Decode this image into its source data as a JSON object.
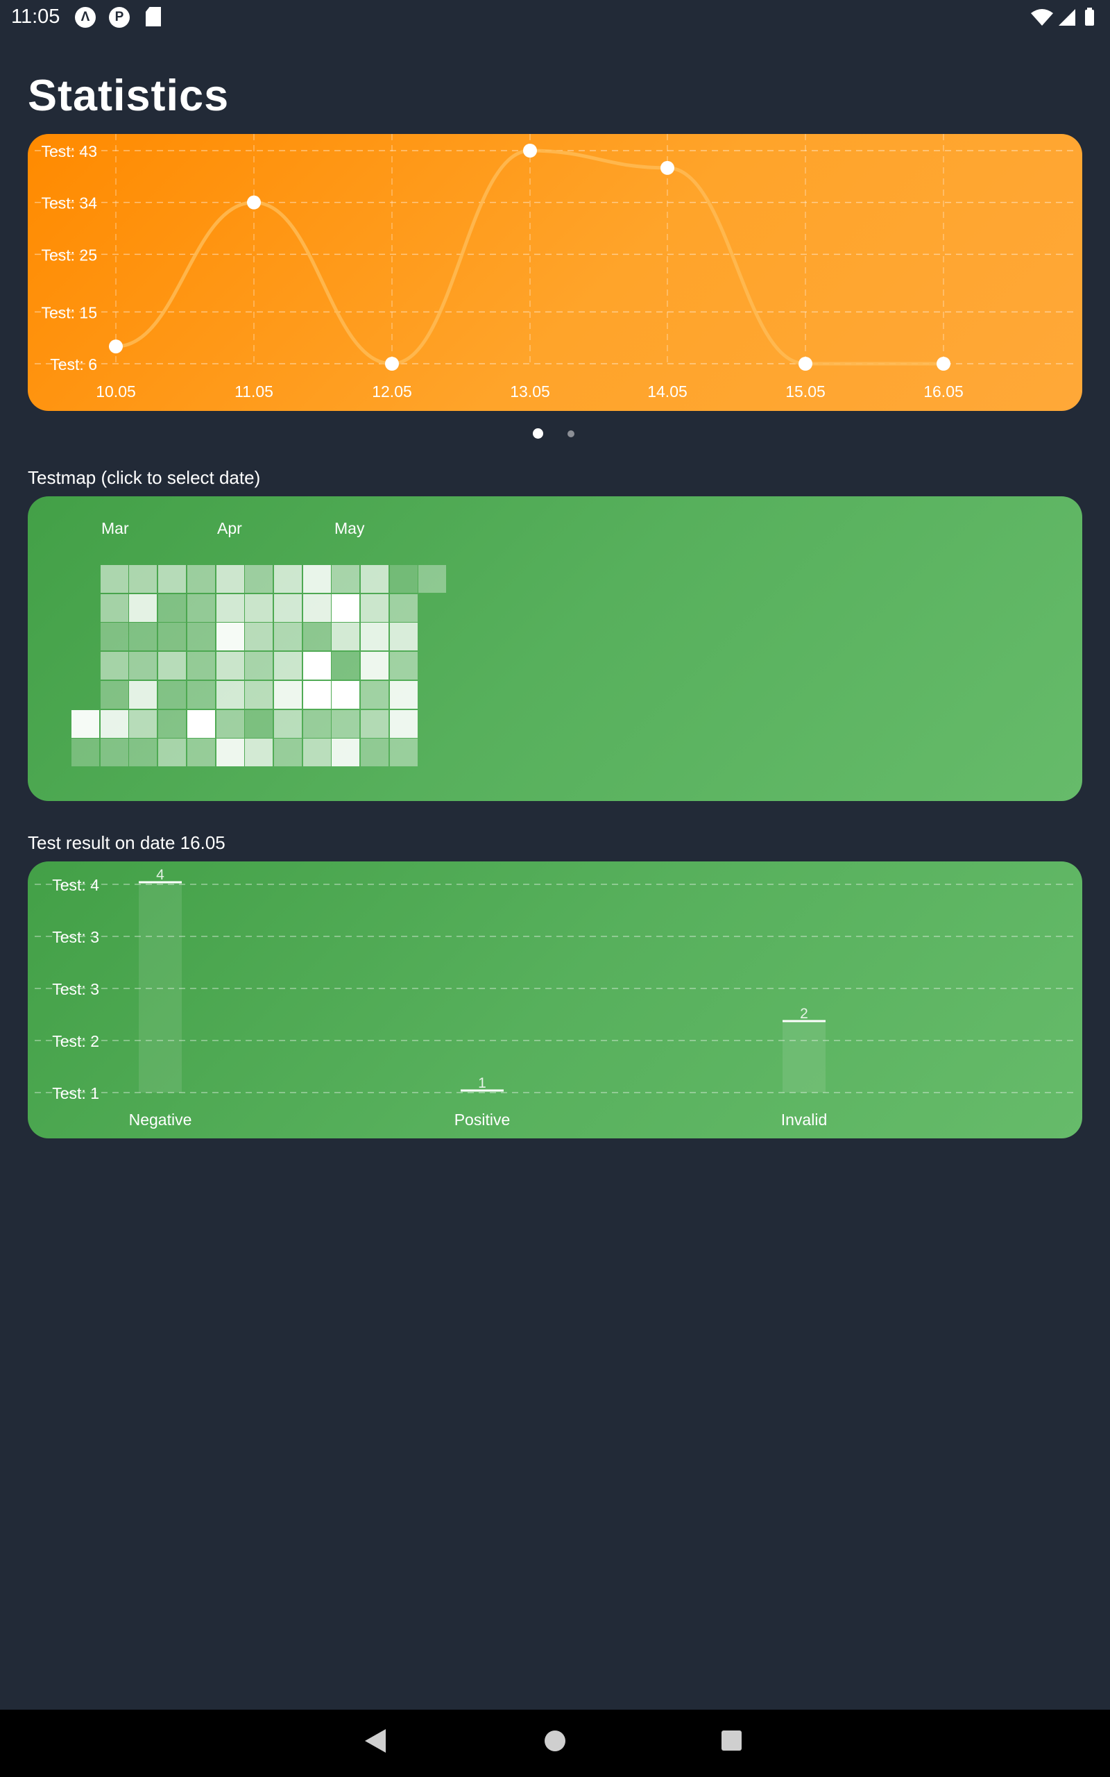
{
  "status_bar": {
    "time": "11:05",
    "left_icons": [
      "app-a-icon",
      "app-p-icon",
      "sd-card-icon"
    ],
    "right_icons": [
      "wifi-icon",
      "signal-icon",
      "battery-icon"
    ]
  },
  "page": {
    "title": "Statistics"
  },
  "line_card": {
    "chart_data": {
      "type": "line",
      "x": [
        "10.05",
        "11.05",
        "12.05",
        "13.05",
        "14.05",
        "15.05",
        "16.05"
      ],
      "values": [
        9,
        34,
        6,
        45,
        40,
        6,
        6
      ],
      "y_tick_labels": [
        "Test: 43",
        "Test: 34",
        "Test: 25",
        "Test: 15",
        "Test: 6"
      ],
      "y_ticks": [
        43,
        34,
        25,
        15,
        6
      ],
      "grid": true,
      "line_color": "#ffbb55",
      "point_color": "#ffffff"
    }
  },
  "pager": {
    "pages": 2,
    "active_index": 0
  },
  "testmap": {
    "label": "Testmap (click to select date)",
    "months": [
      "Mar",
      "Apr",
      "May"
    ],
    "heatmap": {
      "type": "heatmap",
      "note_values": "opacity 0..1 per cell, column-major (weeks), rows = weekdays; null = empty",
      "columns": [
        [
          null,
          null,
          null,
          null,
          null,
          0.95,
          0.25
        ],
        [
          0.55,
          0.5,
          0.3,
          0.5,
          0.3,
          0.88,
          0.3
        ],
        [
          0.55,
          0.85,
          0.3,
          0.45,
          0.85,
          0.6,
          0.3
        ],
        [
          0.6,
          0.3,
          0.3,
          0.6,
          0.3,
          0.3,
          0.5
        ],
        [
          0.45,
          0.4,
          0.35,
          0.4,
          0.35,
          1.0,
          0.4
        ],
        [
          0.72,
          0.75,
          0.95,
          0.7,
          0.75,
          0.45,
          0.9
        ],
        [
          0.45,
          0.7,
          0.6,
          0.5,
          0.6,
          0.25,
          0.75
        ],
        [
          0.72,
          0.75,
          0.55,
          0.7,
          0.9,
          0.6,
          0.4
        ],
        [
          0.88,
          0.85,
          0.35,
          1.0,
          1.0,
          0.4,
          0.6
        ],
        [
          0.5,
          1.0,
          0.75,
          0.25,
          1.0,
          0.45,
          0.9
        ],
        [
          0.7,
          0.7,
          0.85,
          0.9,
          0.45,
          0.55,
          0.35
        ],
        [
          0.2,
          0.45,
          0.78,
          0.45,
          0.9,
          0.9,
          0.4
        ],
        [
          0.35,
          null,
          null,
          null,
          null,
          null,
          null
        ]
      ]
    }
  },
  "result": {
    "label": "Test result on date 16.05",
    "chart_data": {
      "type": "bar",
      "categories": [
        "Negative",
        "Positive",
        "Invalid"
      ],
      "values": [
        4,
        1,
        2
      ],
      "value_labels": [
        "4",
        "1",
        "2"
      ],
      "y_tick_labels": [
        "Test: 4",
        "Test: 3",
        "Test: 3",
        "Test: 2",
        "Test: 1"
      ],
      "y_ticks": [
        4,
        3.25,
        2.5,
        1.75,
        1
      ],
      "grid": true,
      "bar_color": "#ffffff"
    }
  },
  "nav_bar": {
    "buttons": [
      "back-icon",
      "home-icon",
      "recents-icon"
    ]
  }
}
